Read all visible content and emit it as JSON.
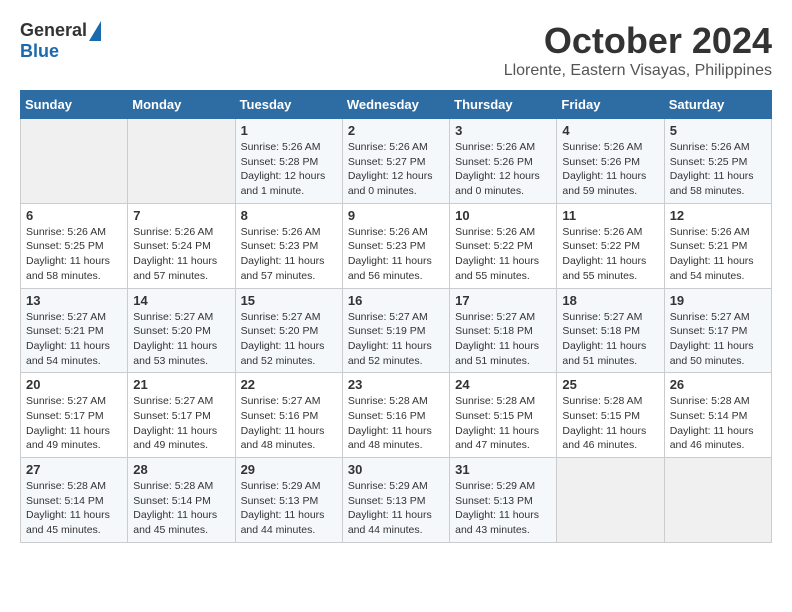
{
  "header": {
    "logo_general": "General",
    "logo_blue": "Blue",
    "month": "October 2024",
    "location": "Llorente, Eastern Visayas, Philippines"
  },
  "days_of_week": [
    "Sunday",
    "Monday",
    "Tuesday",
    "Wednesday",
    "Thursday",
    "Friday",
    "Saturday"
  ],
  "weeks": [
    [
      {
        "day": "",
        "info": ""
      },
      {
        "day": "",
        "info": ""
      },
      {
        "day": "1",
        "info": "Sunrise: 5:26 AM\nSunset: 5:28 PM\nDaylight: 12 hours\nand 1 minute."
      },
      {
        "day": "2",
        "info": "Sunrise: 5:26 AM\nSunset: 5:27 PM\nDaylight: 12 hours\nand 0 minutes."
      },
      {
        "day": "3",
        "info": "Sunrise: 5:26 AM\nSunset: 5:26 PM\nDaylight: 12 hours\nand 0 minutes."
      },
      {
        "day": "4",
        "info": "Sunrise: 5:26 AM\nSunset: 5:26 PM\nDaylight: 11 hours\nand 59 minutes."
      },
      {
        "day": "5",
        "info": "Sunrise: 5:26 AM\nSunset: 5:25 PM\nDaylight: 11 hours\nand 58 minutes."
      }
    ],
    [
      {
        "day": "6",
        "info": "Sunrise: 5:26 AM\nSunset: 5:25 PM\nDaylight: 11 hours\nand 58 minutes."
      },
      {
        "day": "7",
        "info": "Sunrise: 5:26 AM\nSunset: 5:24 PM\nDaylight: 11 hours\nand 57 minutes."
      },
      {
        "day": "8",
        "info": "Sunrise: 5:26 AM\nSunset: 5:23 PM\nDaylight: 11 hours\nand 57 minutes."
      },
      {
        "day": "9",
        "info": "Sunrise: 5:26 AM\nSunset: 5:23 PM\nDaylight: 11 hours\nand 56 minutes."
      },
      {
        "day": "10",
        "info": "Sunrise: 5:26 AM\nSunset: 5:22 PM\nDaylight: 11 hours\nand 55 minutes."
      },
      {
        "day": "11",
        "info": "Sunrise: 5:26 AM\nSunset: 5:22 PM\nDaylight: 11 hours\nand 55 minutes."
      },
      {
        "day": "12",
        "info": "Sunrise: 5:26 AM\nSunset: 5:21 PM\nDaylight: 11 hours\nand 54 minutes."
      }
    ],
    [
      {
        "day": "13",
        "info": "Sunrise: 5:27 AM\nSunset: 5:21 PM\nDaylight: 11 hours\nand 54 minutes."
      },
      {
        "day": "14",
        "info": "Sunrise: 5:27 AM\nSunset: 5:20 PM\nDaylight: 11 hours\nand 53 minutes."
      },
      {
        "day": "15",
        "info": "Sunrise: 5:27 AM\nSunset: 5:20 PM\nDaylight: 11 hours\nand 52 minutes."
      },
      {
        "day": "16",
        "info": "Sunrise: 5:27 AM\nSunset: 5:19 PM\nDaylight: 11 hours\nand 52 minutes."
      },
      {
        "day": "17",
        "info": "Sunrise: 5:27 AM\nSunset: 5:18 PM\nDaylight: 11 hours\nand 51 minutes."
      },
      {
        "day": "18",
        "info": "Sunrise: 5:27 AM\nSunset: 5:18 PM\nDaylight: 11 hours\nand 51 minutes."
      },
      {
        "day": "19",
        "info": "Sunrise: 5:27 AM\nSunset: 5:17 PM\nDaylight: 11 hours\nand 50 minutes."
      }
    ],
    [
      {
        "day": "20",
        "info": "Sunrise: 5:27 AM\nSunset: 5:17 PM\nDaylight: 11 hours\nand 49 minutes."
      },
      {
        "day": "21",
        "info": "Sunrise: 5:27 AM\nSunset: 5:17 PM\nDaylight: 11 hours\nand 49 minutes."
      },
      {
        "day": "22",
        "info": "Sunrise: 5:27 AM\nSunset: 5:16 PM\nDaylight: 11 hours\nand 48 minutes."
      },
      {
        "day": "23",
        "info": "Sunrise: 5:28 AM\nSunset: 5:16 PM\nDaylight: 11 hours\nand 48 minutes."
      },
      {
        "day": "24",
        "info": "Sunrise: 5:28 AM\nSunset: 5:15 PM\nDaylight: 11 hours\nand 47 minutes."
      },
      {
        "day": "25",
        "info": "Sunrise: 5:28 AM\nSunset: 5:15 PM\nDaylight: 11 hours\nand 46 minutes."
      },
      {
        "day": "26",
        "info": "Sunrise: 5:28 AM\nSunset: 5:14 PM\nDaylight: 11 hours\nand 46 minutes."
      }
    ],
    [
      {
        "day": "27",
        "info": "Sunrise: 5:28 AM\nSunset: 5:14 PM\nDaylight: 11 hours\nand 45 minutes."
      },
      {
        "day": "28",
        "info": "Sunrise: 5:28 AM\nSunset: 5:14 PM\nDaylight: 11 hours\nand 45 minutes."
      },
      {
        "day": "29",
        "info": "Sunrise: 5:29 AM\nSunset: 5:13 PM\nDaylight: 11 hours\nand 44 minutes."
      },
      {
        "day": "30",
        "info": "Sunrise: 5:29 AM\nSunset: 5:13 PM\nDaylight: 11 hours\nand 44 minutes."
      },
      {
        "day": "31",
        "info": "Sunrise: 5:29 AM\nSunset: 5:13 PM\nDaylight: 11 hours\nand 43 minutes."
      },
      {
        "day": "",
        "info": ""
      },
      {
        "day": "",
        "info": ""
      }
    ]
  ]
}
